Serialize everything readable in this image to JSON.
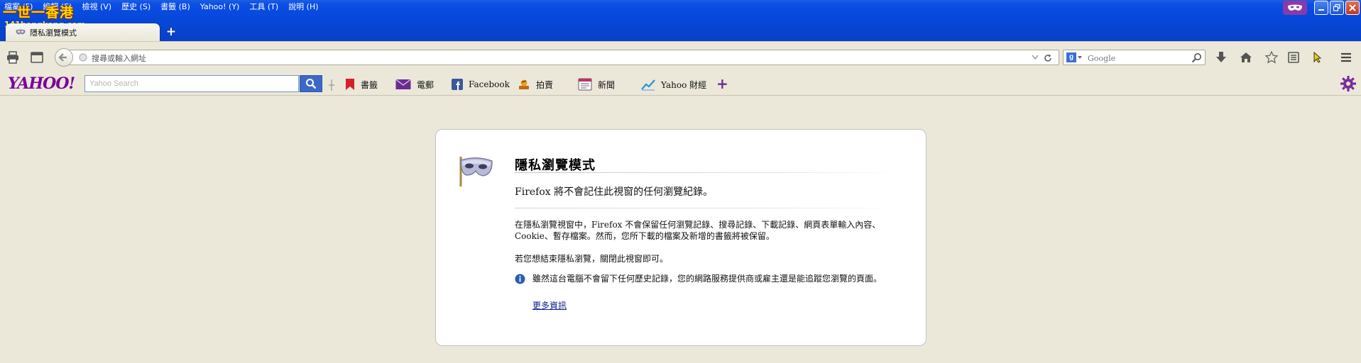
{
  "menu": [
    "檔案 (F)",
    "編輯 (E)",
    "檢視 (V)",
    "歷史 (S)",
    "書籤 (B)",
    "Yahoo! (Y)",
    "工具 (T)",
    "說明 (H)"
  ],
  "watermark": {
    "line1": "一世一香港",
    "line2": "141hongkong.com"
  },
  "tab": {
    "title": "隱私瀏覽模式",
    "new_tab_label": "+"
  },
  "urlbar": {
    "placeholder": "搜尋或輸入網址"
  },
  "searchbar": {
    "placeholder": "Google",
    "engine": "g-icon"
  },
  "yahoo_toolbar": {
    "logo": "YAHOO!",
    "search_placeholder": "Yahoo Search",
    "buttons": {
      "bookmarks": "書籤",
      "mail": "電郵",
      "facebook": "Facebook",
      "auction": "拍賣",
      "news": "新聞",
      "finance": "Yahoo 財經"
    },
    "add_label": "+"
  },
  "private_page": {
    "title": "隱私瀏覽模式",
    "subtitle": "Firefox 將不會記住此視窗的任何瀏覽紀錄。",
    "body": "在隱私瀏覽視窗中，Firefox 不會保留任何瀏覽記錄、搜尋記錄、下載記錄、網頁表單輸入內容、Cookie、暫存檔案。然而，您所下載的檔案及新增的書籤將被保留。",
    "exit_text": "若您想結束隱私瀏覽，關閉此視窗即可。",
    "note": "雖然這台電腦不會留下任何歷史記錄，您的網路服務提供商或雇主還是能追蹤您瀏覽的頁面。",
    "learn_more": "更多資訊"
  },
  "colors": {
    "titlebar_blue": "#0747d8",
    "chrome_beige": "#ebe8d9",
    "yahoo_purple": "#7b0099",
    "link_blue": "#0b1b8f"
  }
}
